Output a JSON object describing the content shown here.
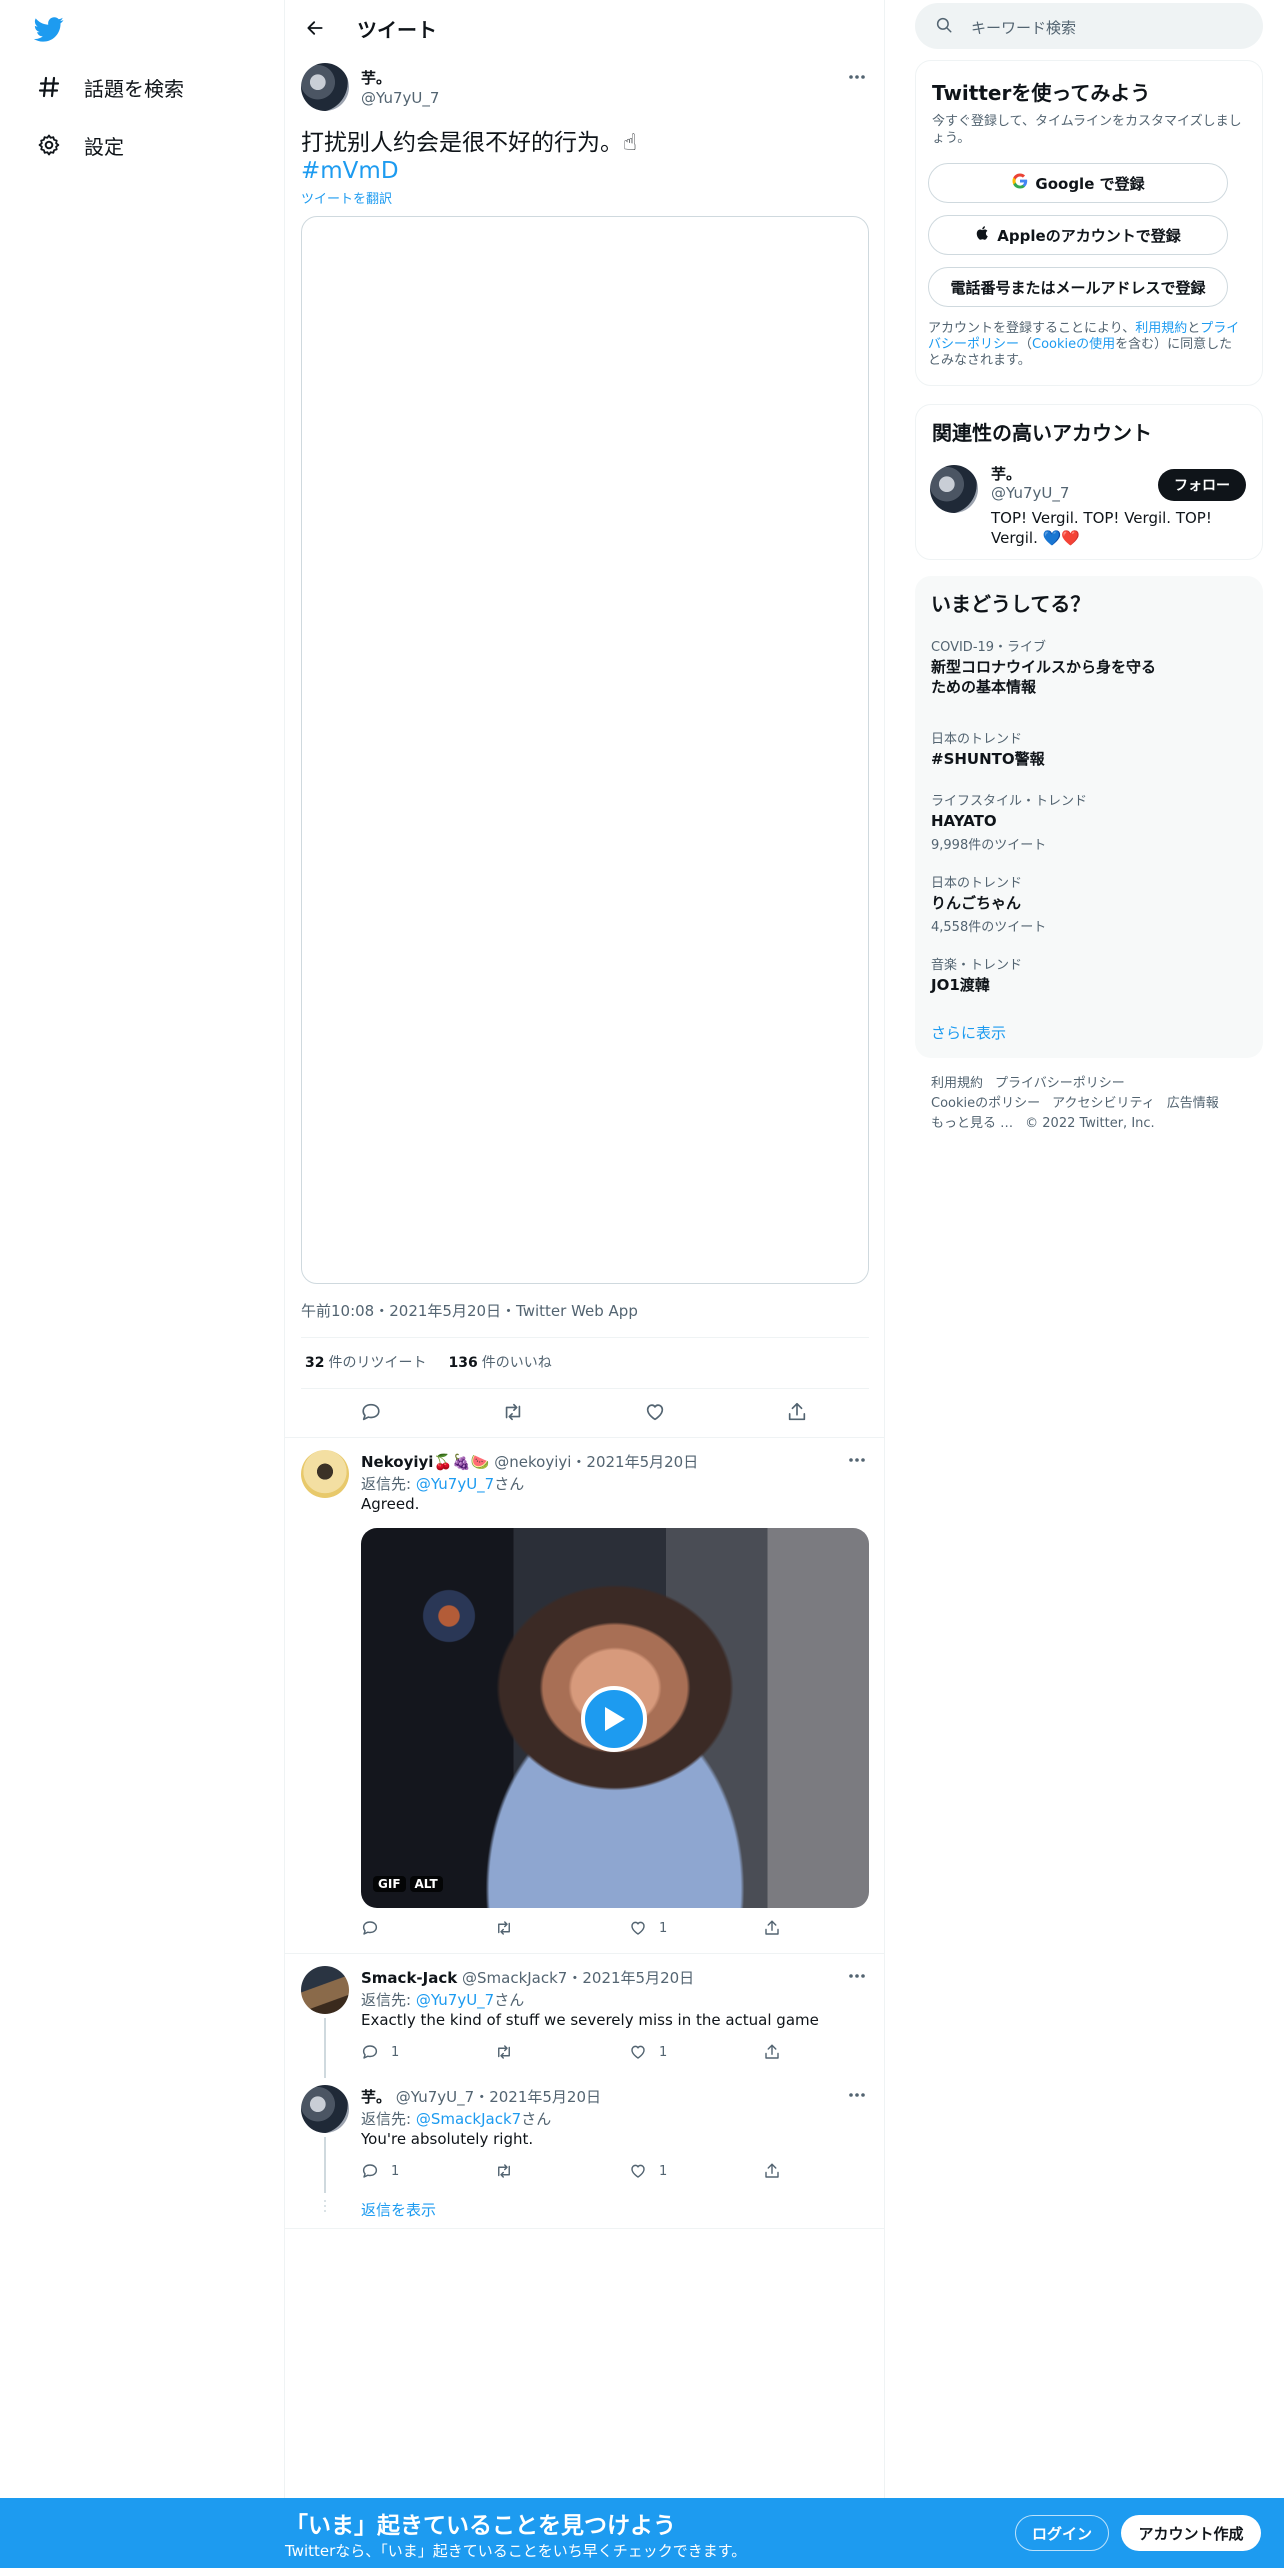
{
  "nav": {
    "items": [
      {
        "label": "話題を検索",
        "icon": "hashtag-icon"
      },
      {
        "label": "設定",
        "icon": "gear-icon"
      }
    ]
  },
  "header": {
    "title": "ツイート"
  },
  "tweet": {
    "author_name": "芋。",
    "author_handle": "@Yu7yU_7",
    "text": "打扰别人约会是很不好的行为。☝",
    "hashtag": "#mVmD",
    "translate_label": "ツイートを翻訳",
    "timestamp": "午前10:08・2021年5月20日・Twitter Web App",
    "retweets_count": "32",
    "retweets_label": "件のリツイート",
    "likes_count": "136",
    "likes_label": "件のいいね"
  },
  "replies": [
    {
      "name": "Nekoyiyi🍒🍇🍉",
      "handle": "@nekoyiyi",
      "date": "・2021年5月20日",
      "to_prefix": "返信先: ",
      "to_handle": "@Yu7yU_7",
      "to_suffix": "さん",
      "text": "Agreed.",
      "gif_label": "GIF",
      "alt_label": "ALT",
      "like_count": "1"
    },
    {
      "name": "Smack-Jack",
      "handle": "@SmackJack7",
      "date": "・2021年5月20日",
      "to_prefix": "返信先: ",
      "to_handle": "@Yu7yU_7",
      "to_suffix": "さん",
      "text": "Exactly the kind of stuff we severely miss in the actual game",
      "reply_count": "1",
      "like_count": "1"
    },
    {
      "name": "芋。",
      "handle": "@Yu7yU_7",
      "date": "・2021年5月20日",
      "to_prefix": "返信先: ",
      "to_handle": "@SmackJack7",
      "to_suffix": "さん",
      "text": "You're absolutely right.",
      "reply_count": "1",
      "like_count": "1"
    }
  ],
  "show_replies": "返信を表示",
  "search": {
    "placeholder": "キーワード検索"
  },
  "signup_card": {
    "title": "Twitterを使ってみよう",
    "subtitle": "今すぐ登録して、タイムラインをカスタマイズしましょう。",
    "google": "Google で登録",
    "apple": "Appleのアカウントで登録",
    "phone": "電話番号またはメールアドレスで登録",
    "terms_pre": "アカウントを登録することにより、",
    "terms_link1": "利用規約",
    "terms_mid1": "と",
    "terms_link2": "プライバシーポリシー",
    "terms_mid2": "（",
    "terms_link3": "Cookieの使用",
    "terms_post": "を含む）に同意したとみなされます。"
  },
  "related": {
    "title": "関連性の高いアカウント",
    "name": "芋。",
    "handle": "@Yu7yU_7",
    "follow": "フォロー",
    "bio": "TOP! Vergil. TOP! Vergil. TOP! Vergil. 💙❤️"
  },
  "trends": {
    "title": "いまどうしてる？",
    "items": [
      {
        "category": "COVID-19・ライブ",
        "name": "新型コロナウイルスから身を守るための基本情報",
        "count": ""
      },
      {
        "category": "日本のトレンド",
        "name": "#SHUNTO警報",
        "count": ""
      },
      {
        "category": "ライフスタイル・トレンド",
        "name": "HAYATO",
        "count": "9,998件のツイート"
      },
      {
        "category": "日本のトレンド",
        "name": "りんごちゃん",
        "count": "4,558件のツイート"
      },
      {
        "category": "音楽・トレンド",
        "name": "JO1渡韓",
        "count": ""
      }
    ],
    "show_more": "さらに表示"
  },
  "footer": {
    "terms": "利用規約",
    "privacy": "プライバシーポリシー",
    "cookie": "Cookieのポリシー",
    "accessibility": "アクセシビリティ",
    "ads": "広告情報",
    "more": "もっと見る …",
    "copyright": "© 2022 Twitter, Inc."
  },
  "banner": {
    "title": "「いま」起きていることを見つけよう",
    "subtitle": "Twitterなら、「いま」起きていることをいち早くチェックできます。",
    "login": "ログイン",
    "signup": "アカウント作成"
  },
  "colors": {
    "accent": "#1d9bf0",
    "text": "#0f1419",
    "muted": "#536471"
  }
}
